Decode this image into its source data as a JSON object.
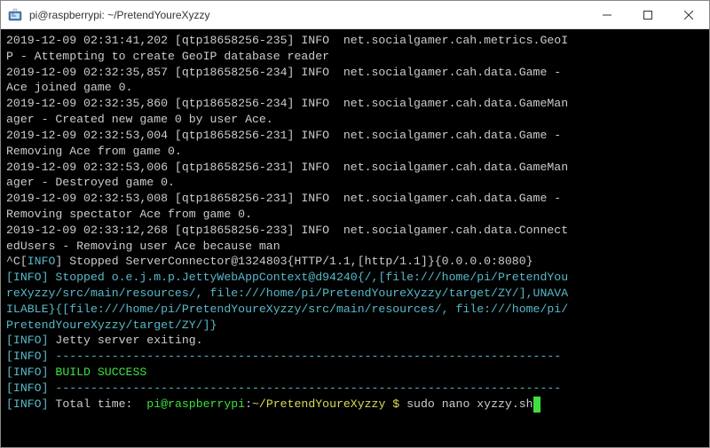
{
  "window": {
    "title": "pi@raspberrypi: ~/PretendYoureXyzzy"
  },
  "log": {
    "l1a": "2019-12-09 02:31:41,202 [qtp18658256-235] INFO  net.socialgamer.cah.metrics.GeoI",
    "l1b": "P - Attempting to create GeoIP database reader",
    "l2a": "2019-12-09 02:32:35,857 [qtp18658256-234] INFO  net.socialgamer.cah.data.Game - ",
    "l2b": "Ace joined game 0.",
    "l3a": "2019-12-09 02:32:35,860 [qtp18658256-234] INFO  net.socialgamer.cah.data.GameMan",
    "l3b": "ager - Created new game 0 by user Ace.",
    "l4a": "2019-12-09 02:32:53,004 [qtp18658256-231] INFO  net.socialgamer.cah.data.Game - ",
    "l4b": "Removing Ace from game 0.",
    "l5a": "2019-12-09 02:32:53,006 [qtp18658256-231] INFO  net.socialgamer.cah.data.GameMan",
    "l5b": "ager - Destroyed game 0.",
    "l6a": "2019-12-09 02:32:53,008 [qtp18658256-231] INFO  net.socialgamer.cah.data.Game - ",
    "l6b": "Removing spectator Ace from game 0.",
    "l7a": "2019-12-09 02:33:12,268 [qtp18658256-233] INFO  net.socialgamer.cah.data.Connect",
    "l7b": "edUsers - Removing user Ace because man",
    "ctrlc": "^C[",
    "info": "INFO",
    "br_open": "[",
    "br_close": "] ",
    "stop1": "] Stopped ServerConnector@1324803{HTTP/1.1,[http/1.1]}{0.0.0.0:8080}",
    "stop2a": "] Stopped o.e.j.m.p.JettyWebAppContext@d94240{/,[file:///home/pi/PretendYou",
    "stop2b": "reXyzzy/src/main/resources/, file:///home/pi/PretendYoureXyzzy/target/ZY/],UNAVA",
    "stop2c": "ILABLE}{[file:///home/pi/PretendYoureXyzzy/src/main/resources/, file:///home/pi/",
    "stop2d": "PretendYoureXyzzy/target/ZY/]}",
    "exit": "Jetty server exiting.",
    "dash": "------------------------------------------------------------------------",
    "build": "BUILD SUCCESS",
    "total": "Total time:  ",
    "prompt_user": "pi@raspberrypi",
    "prompt_colon": ":",
    "prompt_path": "~/PretendYoureXyzzy $",
    "cmd": " sudo nano xyzzy.sh"
  }
}
